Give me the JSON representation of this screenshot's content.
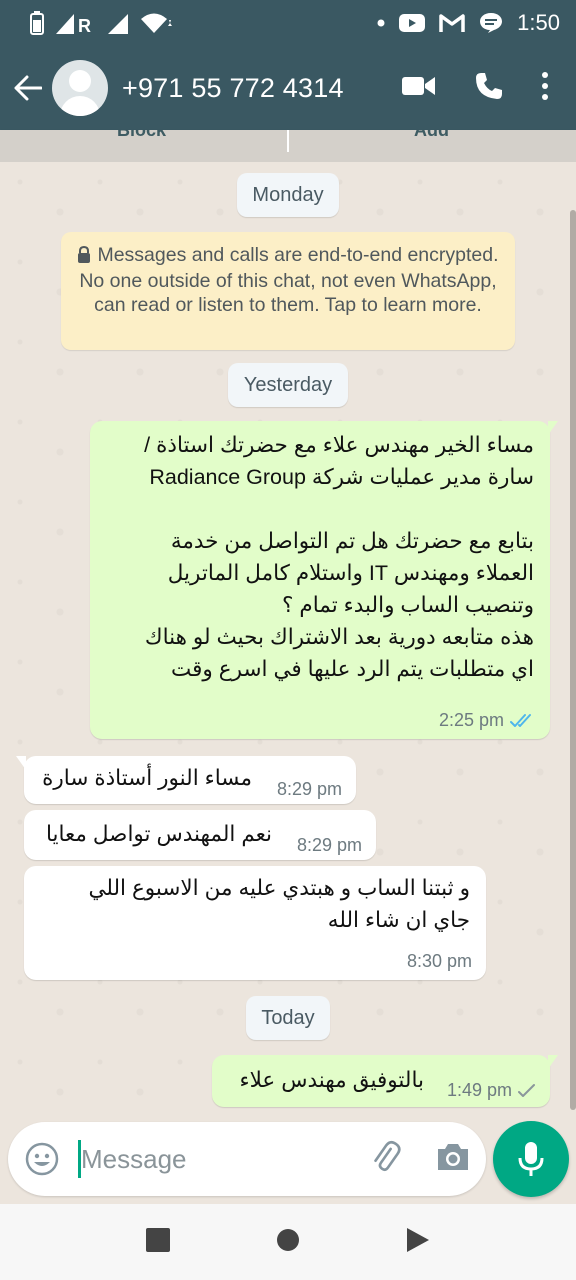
{
  "status_bar": {
    "time": "1:50",
    "left_icons": [
      "battery-icon",
      "signal-r-icon",
      "signal-icon",
      "wifi-icon"
    ],
    "right_icons": [
      "dot-icon",
      "youtube-icon",
      "gmail-icon",
      "messages-icon"
    ]
  },
  "header": {
    "contact_name": "+971 55 772 4314",
    "colors": {
      "bar": "#3a5862",
      "accent": "#00a884"
    }
  },
  "peek_banner": {
    "left_label": "Block",
    "right_label": "Add"
  },
  "chat": {
    "date_monday": "Monday",
    "encryption_notice": "Messages and calls are end-to-end encrypted. No one outside of this chat, not even WhatsApp, can read or listen to them. Tap to learn more.",
    "date_yesterday": "Yesterday",
    "date_today": "Today",
    "messages": [
      {
        "direction": "outgoing",
        "text": "مساء الخير مهندس علاء مع حضرتك استاذة /\nسارة مدير عمليات شركة Radiance Group\n\nبتابع مع حضرتك هل تم التواصل من خدمة\nالعملاء ومهندس IT واستلام كامل الماتريل\nوتنصيب الساب والبدء تمام ؟\nهذه متابعه دورية بعد الاشتراك بحيث لو هناك\nاي متطلبات يتم الرد عليها في اسرع وقت",
        "time": "2:25 pm",
        "status": "read"
      },
      {
        "direction": "incoming",
        "text": "مساء النور أستاذة سارة",
        "time": "8:29 pm"
      },
      {
        "direction": "incoming",
        "text": "نعم المهندس تواصل معايا",
        "time": "8:29 pm"
      },
      {
        "direction": "incoming",
        "text": "و ثبتنا الساب و هبتدي عليه من الاسبوع اللي\nجاي ان شاء الله",
        "time": "8:30 pm"
      },
      {
        "direction": "outgoing",
        "text": "بالتوفيق مهندس علاء",
        "time": "1:49 pm",
        "status": "delivered"
      }
    ]
  },
  "composer": {
    "placeholder": "Message"
  }
}
